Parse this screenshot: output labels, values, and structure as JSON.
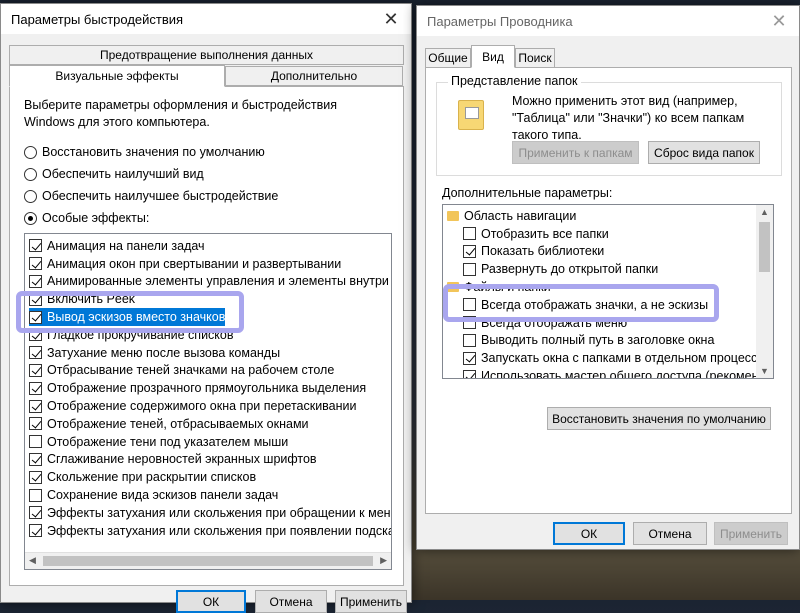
{
  "perf_window": {
    "title": "Параметры быстродействия",
    "tabs": {
      "dep": "Предотвращение выполнения данных",
      "visual": "Визуальные эффекты",
      "advanced": "Дополнительно"
    },
    "description": "Выберите параметры оформления и быстродействия Windows для этого компьютера.",
    "radios": [
      {
        "label": "Восстановить значения по умолчанию",
        "selected": false
      },
      {
        "label": "Обеспечить наилучший вид",
        "selected": false
      },
      {
        "label": "Обеспечить наилучшее быстродействие",
        "selected": false
      },
      {
        "label": "Особые эффекты:",
        "selected": true
      }
    ],
    "effects": [
      {
        "label": "Анимация на панели задач",
        "checked": true
      },
      {
        "label": "Анимация окон при свертывании и развертывании",
        "checked": true
      },
      {
        "label": "Анимированные элементы управления и элементы внутри окн",
        "checked": true
      },
      {
        "label": "Включить Peek",
        "checked": true
      },
      {
        "label": "Вывод эскизов вместо значков",
        "checked": true
      },
      {
        "label": "Гладкое прокручивание списков",
        "checked": true
      },
      {
        "label": "Затухание меню после вызова команды",
        "checked": true
      },
      {
        "label": "Отбрасывание теней значками на рабочем столе",
        "checked": true
      },
      {
        "label": "Отображение прозрачного прямоугольника выделения",
        "checked": true
      },
      {
        "label": "Отображение содержимого окна при перетаскивании",
        "checked": true
      },
      {
        "label": "Отображение теней, отбрасываемых окнами",
        "checked": true
      },
      {
        "label": "Отображение тени под указателем мыши",
        "checked": false
      },
      {
        "label": "Сглаживание неровностей экранных шрифтов",
        "checked": true
      },
      {
        "label": "Скольжение при раскрытии списков",
        "checked": true
      },
      {
        "label": "Сохранение вида эскизов панели задач",
        "checked": false
      },
      {
        "label": "Эффекты затухания или скольжения при обращении к меню",
        "checked": true
      },
      {
        "label": "Эффекты затухания или скольжения при появлении подсказок",
        "checked": true
      }
    ],
    "buttons": {
      "ok": "ОК",
      "cancel": "Отмена",
      "apply": "Применить"
    }
  },
  "explorer_window": {
    "title": "Параметры Проводника",
    "tabs": {
      "general": "Общие",
      "view": "Вид",
      "search": "Поиск"
    },
    "folder_view": {
      "group_label": "Представление папок",
      "description": "Можно применить этот вид (например, \"Таблица\" или \"Значки\") ко всем папкам такого типа.",
      "apply_button": "Применить к папкам",
      "reset_button": "Сброс вида папок"
    },
    "advanced_label": "Дополнительные параметры:",
    "tree": [
      {
        "type": "folder",
        "label": "Область навигации",
        "indent": 0,
        "icon": "nav-pane-icon"
      },
      {
        "type": "checkbox",
        "label": "Отобразить все папки",
        "checked": false,
        "indent": 1
      },
      {
        "type": "checkbox",
        "label": "Показать библиотеки",
        "checked": true,
        "indent": 1
      },
      {
        "type": "checkbox",
        "label": "Развернуть до открытой папки",
        "checked": false,
        "indent": 1
      },
      {
        "type": "folder",
        "label": "Файлы и папки",
        "indent": 0,
        "icon": "folder-icon"
      },
      {
        "type": "checkbox",
        "label": "Всегда отображать значки, а не эскизы",
        "checked": false,
        "indent": 1
      },
      {
        "type": "checkbox",
        "label": "Всегда отображать меню",
        "checked": false,
        "indent": 1
      },
      {
        "type": "checkbox",
        "label": "Выводить полный путь в заголовке окна",
        "checked": false,
        "indent": 1
      },
      {
        "type": "checkbox",
        "label": "Запускать окна с папками в отдельном процессе",
        "checked": true,
        "indent": 1
      },
      {
        "type": "checkbox",
        "label": "Использовать мастер общего доступа (рекомендует",
        "checked": true,
        "indent": 1
      }
    ],
    "restore_defaults": "Восстановить значения по умолчанию",
    "buttons": {
      "ok": "ОК",
      "cancel": "Отмена",
      "apply": "Применить"
    }
  },
  "colors": {
    "highlight": "#a9a6ee",
    "selection": "#0078d7",
    "accent_border": "#0078d7"
  }
}
